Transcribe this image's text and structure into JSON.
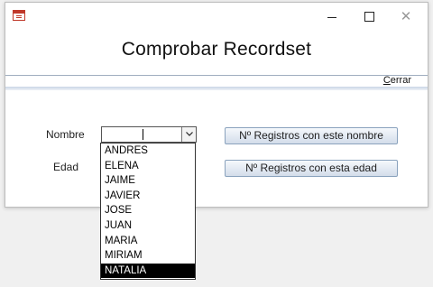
{
  "header": {
    "title": "Comprobar Recordset"
  },
  "toolbar": {
    "close_prefix": "",
    "close_accel": "C",
    "close_rest": "errar",
    "max_glyph": "",
    "close_glyph": "✕"
  },
  "form": {
    "nombre_label": "Nombre",
    "edad_label": "Edad",
    "btn_nombre": "Nº Registros con este nombre",
    "btn_edad": "Nº Registros con esta edad"
  },
  "dropdown": {
    "items": [
      "ANDRES",
      "ELENA",
      "JAIME",
      "JAVIER",
      "JOSE",
      "JUAN",
      "MARIA",
      "MIRIAM",
      "NATALIA"
    ],
    "selected_index": 8
  }
}
